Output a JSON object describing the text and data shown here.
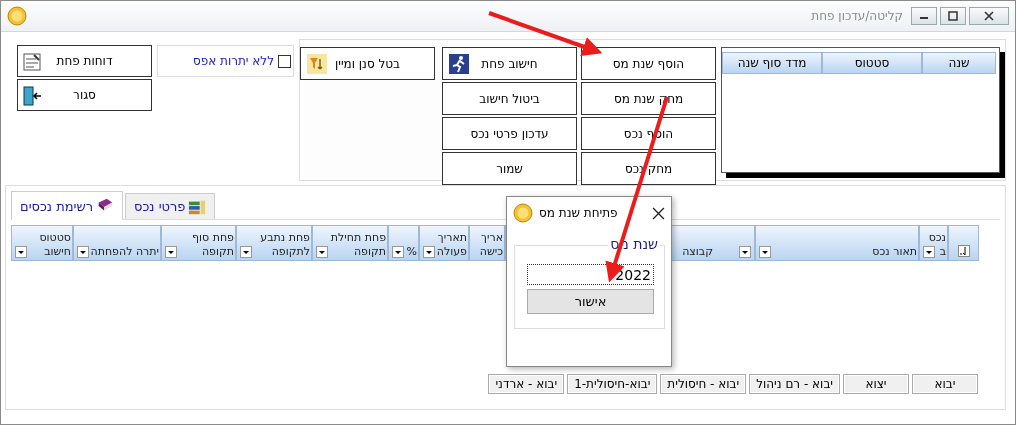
{
  "window": {
    "title": "קליטה/עדכון פחת"
  },
  "years_grid": {
    "columns": [
      "שנה",
      "סטטוס",
      "מדד סוף שנה"
    ]
  },
  "action_columns": [
    [
      "הוסף שנת מס",
      "מחק שנת מס",
      "הוסף נכס",
      "מחק נכס"
    ],
    [
      "חישוב פחת",
      "ביטול חישוב",
      "עדכון פרטי נכס",
      "שמור"
    ]
  ],
  "filter_button": "בטל סנן ומיין",
  "zero_balance_checkbox": {
    "label": "ללא יתרות אפס",
    "checked": false
  },
  "side_buttons": [
    "דוחות פחת",
    "סגור"
  ],
  "tabs": [
    {
      "kind": "details",
      "label": "פרטי נכס",
      "selected": false
    },
    {
      "kind": "list",
      "label": "רשימת נכסים",
      "selected": true
    }
  ],
  "assets_grid": {
    "columns": [
      {
        "kind": "sort"
      },
      {
        "kind": "text",
        "lines": [
          "נכס",
          "ב"
        ],
        "filter": true
      },
      {
        "kind": "text",
        "lines": [
          "תאור נכס"
        ],
        "filter": true
      },
      {
        "kind": "text",
        "lines": [
          "קבוצה"
        ],
        "filter": true
      },
      {
        "kind": "text",
        "lines": [
          "אריך",
          "כישה"
        ],
        "filter": false
      },
      {
        "kind": "text",
        "lines": [
          "תאריך",
          "פעולה"
        ],
        "filter": true
      },
      {
        "kind": "text",
        "lines": [
          "%"
        ],
        "filter": true
      },
      {
        "kind": "text",
        "lines": [
          "פחת תחילת",
          "תקופה"
        ],
        "filter": true
      },
      {
        "kind": "text",
        "lines": [
          "פחת נתבע",
          "לתקופה"
        ],
        "filter": true
      },
      {
        "kind": "text",
        "lines": [
          "פחת סוף",
          "תקופה"
        ],
        "filter": true
      },
      {
        "kind": "text",
        "lines": [
          "יתרה להפחתה"
        ],
        "filter": true
      },
      {
        "kind": "text",
        "lines": [
          "סטטוס",
          "חישוב"
        ],
        "filter": true
      }
    ]
  },
  "import_buttons": [
    "יבוא",
    "יצוא",
    "יבוא - רם ניהול",
    "יבוא - חיסולית",
    "יבוא-חיסולית-1",
    "יבוא - ארדני"
  ],
  "dialog": {
    "title": "פתיחת שנת מס",
    "group_label": "שנת מס",
    "value": "2022",
    "button": "אישור"
  }
}
